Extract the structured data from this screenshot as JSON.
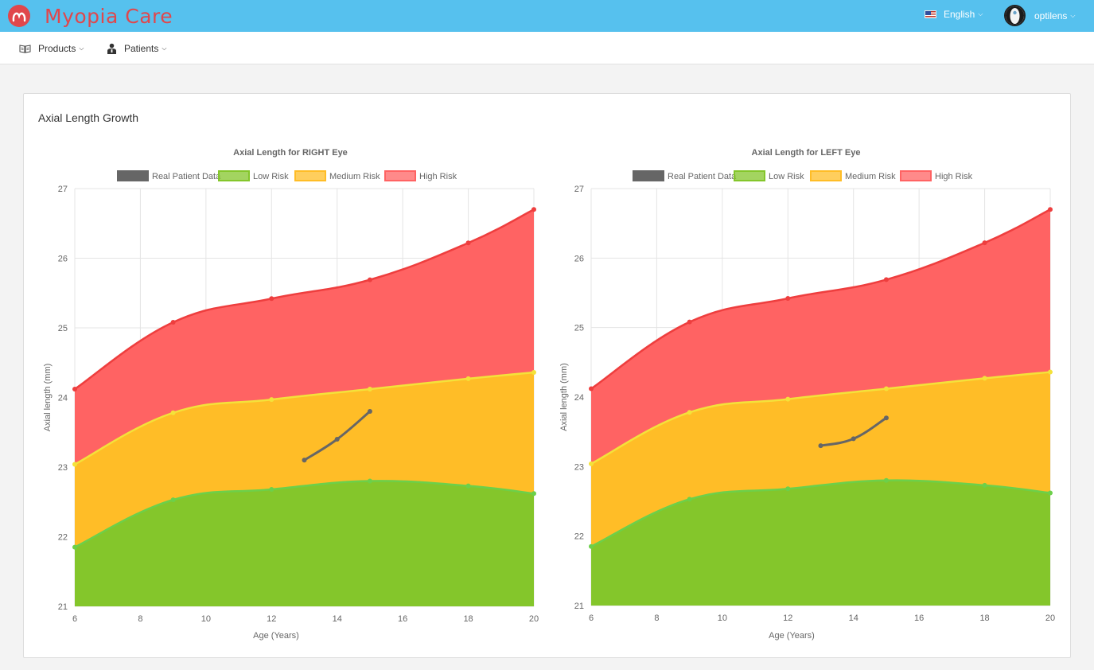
{
  "app": {
    "name": "Myopia Care"
  },
  "topbar": {
    "language_label": "English",
    "user_label": "optilens"
  },
  "menu": {
    "items": [
      {
        "label": "Products"
      },
      {
        "label": "Patients"
      }
    ]
  },
  "card": {
    "title": "Axial Length Growth"
  },
  "colors": {
    "header": "#56c1ee",
    "brand": "#e0474c",
    "high_risk": "#ff6363",
    "medium_risk": "#ffbd27",
    "low_risk": "#84c62b",
    "patient": "#666666"
  },
  "chart_data": [
    {
      "type": "area",
      "title": "Axial Length for RIGHT Eye",
      "xlabel": "Age (Years)",
      "ylabel": "Axial length (mm)",
      "xlim": [
        6,
        20
      ],
      "ylim": [
        21,
        27
      ],
      "x_ticks": [
        6,
        8,
        10,
        12,
        14,
        16,
        18,
        20
      ],
      "y_ticks": [
        21,
        22,
        23,
        24,
        25,
        26,
        27
      ],
      "grid": true,
      "legend_position": "top",
      "series": [
        {
          "name": "Real Patient Data",
          "color": "#666666",
          "x": [
            13,
            14,
            15
          ],
          "values": [
            23.1,
            23.4,
            23.8
          ]
        },
        {
          "name": "Low Risk",
          "color": "#84c62b",
          "x": [
            6,
            9,
            12,
            15,
            18,
            20
          ],
          "values": [
            21.85,
            22.53,
            22.68,
            22.8,
            22.73,
            22.62
          ]
        },
        {
          "name": "Medium Risk",
          "color": "#ffbd27",
          "x": [
            6,
            9,
            12,
            15,
            18,
            20
          ],
          "values": [
            23.04,
            23.78,
            23.97,
            24.12,
            24.27,
            24.36
          ]
        },
        {
          "name": "High Risk",
          "color": "#ff6363",
          "x": [
            6,
            9,
            12,
            15,
            18,
            20
          ],
          "values": [
            24.12,
            25.08,
            25.42,
            25.69,
            26.22,
            26.7
          ]
        }
      ]
    },
    {
      "type": "area",
      "title": "Axial Length for LEFT Eye",
      "xlabel": "Age (Years)",
      "ylabel": "Axial length (mm)",
      "xlim": [
        6,
        20
      ],
      "ylim": [
        21,
        27
      ],
      "x_ticks": [
        6,
        8,
        10,
        12,
        14,
        16,
        18,
        20
      ],
      "y_ticks": [
        21,
        22,
        23,
        24,
        25,
        26,
        27
      ],
      "grid": true,
      "legend_position": "top",
      "series": [
        {
          "name": "Real Patient Data",
          "color": "#666666",
          "x": [
            13,
            14,
            15
          ],
          "values": [
            23.3,
            23.4,
            23.7
          ]
        },
        {
          "name": "Low Risk",
          "color": "#84c62b",
          "x": [
            6,
            9,
            12,
            15,
            18,
            20
          ],
          "values": [
            21.85,
            22.53,
            22.68,
            22.8,
            22.73,
            22.62
          ]
        },
        {
          "name": "Medium Risk",
          "color": "#ffbd27",
          "x": [
            6,
            9,
            12,
            15,
            18,
            20
          ],
          "values": [
            23.04,
            23.78,
            23.97,
            24.12,
            24.27,
            24.36
          ]
        },
        {
          "name": "High Risk",
          "color": "#ff6363",
          "x": [
            6,
            9,
            12,
            15,
            18,
            20
          ],
          "values": [
            24.12,
            25.08,
            25.42,
            25.69,
            26.22,
            26.7
          ]
        }
      ]
    }
  ]
}
